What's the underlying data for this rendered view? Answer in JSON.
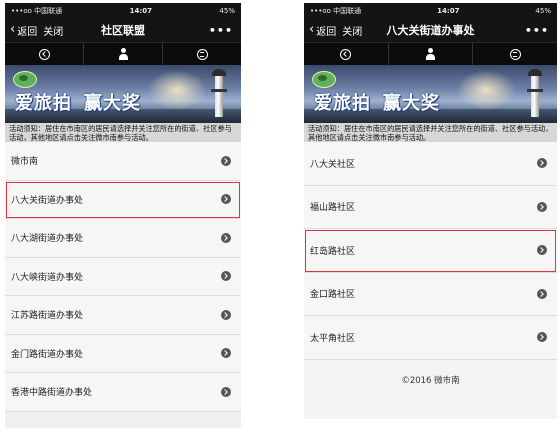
{
  "left": {
    "status": {
      "carrier": "•••oo 中国联通 ",
      "time": "14:07",
      "battery": "45%"
    },
    "nav": {
      "back_label": "返回",
      "close_label": "关闭",
      "title": "社区联盟",
      "more": "•••"
    },
    "banner": {
      "slogan_1": "爱旅拍",
      "slogan_2": "赢大奖"
    },
    "notice": "活动须知：居住在市南区的居民请选择并关注您所在的街道、社区参与活动，其他地区请点击关注微市南参与活动。",
    "items": [
      {
        "label": "微市南"
      },
      {
        "label": "八大关街道办事处"
      },
      {
        "label": "八大湖街道办事处"
      },
      {
        "label": "八大峡街道办事处"
      },
      {
        "label": "江苏路街道办事处"
      },
      {
        "label": "金门路街道办事处"
      },
      {
        "label": "香港中路街道办事处"
      }
    ],
    "highlighted_index": 1
  },
  "right": {
    "status": {
      "carrier": "•••oo 中国联通 ",
      "time": "14:07",
      "battery": "45%"
    },
    "nav": {
      "back_label": "返回",
      "close_label": "关闭",
      "title": "八大关街道办事处",
      "more": "•••"
    },
    "banner": {
      "slogan_1": "爱旅拍",
      "slogan_2": "赢大奖"
    },
    "notice": "活动须知：居住在市南区的居民请选择并关注您所在的街道、社区参与活动，其他地区请点击关注微市南参与活动。",
    "items": [
      {
        "label": "八大关社区"
      },
      {
        "label": "福山路社区"
      },
      {
        "label": "红岛路社区"
      },
      {
        "label": "金口路社区"
      },
      {
        "label": "太平角社区"
      }
    ],
    "highlighted_index": 2,
    "footer": "©2016 微市南"
  },
  "colors": {
    "highlight": "#d9363e",
    "bar": "#141414"
  },
  "icons": {
    "tab_1": "circle-back-icon",
    "tab_2": "person-icon",
    "tab_3": "circle-menu-icon",
    "row_arrow": "chevron-right-circle-icon"
  }
}
